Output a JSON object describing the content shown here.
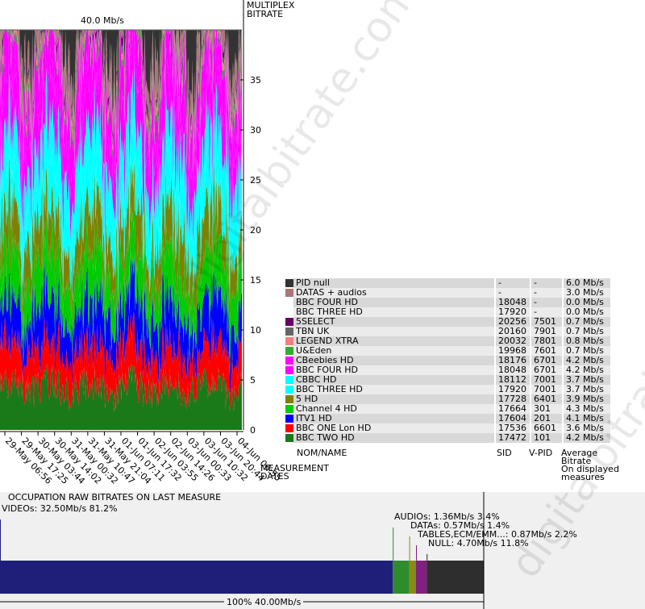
{
  "chart_data": {
    "type": "area",
    "stacked": true,
    "top_label": "40.0 Mb/s",
    "ylabel": "MULTIPLEX BITRATE",
    "xlabel": "MEASUREMENT DATES",
    "ylim": [
      0,
      40
    ],
    "yticks": [
      5,
      10,
      15,
      20,
      25,
      30,
      35
    ],
    "xticks": [
      "29-May 06:56",
      "29-May 17:25",
      "30-May 03:44",
      "30-May 14:02",
      "31-May 00:32",
      "31-May 10:47",
      "31-May 21:04",
      "01-Jun 07:11",
      "01-Jun 17:32",
      "02-Jun 03:55",
      "02-Jun 14:26",
      "03-Jun 00:33",
      "03-Jun 10:32",
      "03-Jun 20:44",
      "04-Jun 06:55"
    ],
    "series": [
      {
        "name": "BBC TWO HD",
        "color": "#1a7a1a",
        "avg": 4.2
      },
      {
        "name": "BBC ONE Lon HD",
        "color": "#ff0000",
        "avg": 3.6
      },
      {
        "name": "ITV1 HD",
        "color": "#0000ff",
        "avg": 4.1
      },
      {
        "name": "Channel 4 HD",
        "color": "#00cc00",
        "avg": 4.3
      },
      {
        "name": "5 HD",
        "color": "#808000",
        "avg": 3.9
      },
      {
        "name": "BBC THREE HD",
        "color": "#00ffff",
        "avg": 3.7
      },
      {
        "name": "CBBC HD",
        "color": "#00ffff",
        "avg": 3.7
      },
      {
        "name": "BBC FOUR HD",
        "color": "#ff00ff",
        "avg": 4.2
      },
      {
        "name": "CBeebies HD",
        "color": "#ff00ff",
        "avg": 4.2
      },
      {
        "name": "U&Eden",
        "color": "#33aa33",
        "avg": 0.7
      },
      {
        "name": "LEGEND XTRA",
        "color": "#f08080",
        "avg": 0.7
      },
      {
        "name": "TBN UK",
        "color": "#666666",
        "avg": 0.7
      },
      {
        "name": "5SELECT",
        "color": "#660066",
        "avg": 0.7
      },
      {
        "name": "DATAS + audios",
        "color": "#aa7777",
        "avg": 3.0
      },
      {
        "name": "PID null",
        "color": "#333333",
        "avg": 6.0
      }
    ]
  },
  "legend": {
    "rows": [
      {
        "name": "PID null",
        "sid": "-",
        "vpid": "-",
        "bitrate": "6.0 Mb/s",
        "color": "#333333"
      },
      {
        "name": "DATAS + audios",
        "sid": "-",
        "vpid": "-",
        "bitrate": "3.0 Mb/s",
        "color": "#aa7777"
      },
      {
        "name": "BBC FOUR HD",
        "sid": "18048",
        "vpid": "-",
        "bitrate": "0.0 Mb/s",
        "color": ""
      },
      {
        "name": "BBC THREE HD",
        "sid": "17920",
        "vpid": "-",
        "bitrate": "0.0 Mb/s",
        "color": ""
      },
      {
        "name": "5SELECT",
        "sid": "20256",
        "vpid": "7501",
        "bitrate": "0.7 Mb/s",
        "color": "#660066"
      },
      {
        "name": "TBN UK",
        "sid": "20160",
        "vpid": "7901",
        "bitrate": "0.7 Mb/s",
        "color": "#666666"
      },
      {
        "name": "LEGEND XTRA",
        "sid": "20032",
        "vpid": "7801",
        "bitrate": "0.8 Mb/s",
        "color": "#f08080"
      },
      {
        "name": "U&Eden",
        "sid": "19968",
        "vpid": "7601",
        "bitrate": "0.7 Mb/s",
        "color": "#33aa33"
      },
      {
        "name": "CBeebies HD",
        "sid": "18176",
        "vpid": "6701",
        "bitrate": "4.2 Mb/s",
        "color": "#ff00ff"
      },
      {
        "name": "BBC FOUR HD",
        "sid": "18048",
        "vpid": "6701",
        "bitrate": "4.2 Mb/s",
        "color": "#ff00ff"
      },
      {
        "name": "CBBC HD",
        "sid": "18112",
        "vpid": "7001",
        "bitrate": "3.7 Mb/s",
        "color": "#00ffff"
      },
      {
        "name": "BBC THREE HD",
        "sid": "17920",
        "vpid": "7001",
        "bitrate": "3.7 Mb/s",
        "color": "#00ffff"
      },
      {
        "name": "5 HD",
        "sid": "17728",
        "vpid": "6401",
        "bitrate": "3.9 Mb/s",
        "color": "#808000"
      },
      {
        "name": "Channel 4 HD",
        "sid": "17664",
        "vpid": "301",
        "bitrate": "4.3 Mb/s",
        "color": "#00cc00"
      },
      {
        "name": "ITV1 HD",
        "sid": "17604",
        "vpid": "201",
        "bitrate": "4.1 Mb/s",
        "color": "#0000ff"
      },
      {
        "name": "BBC ONE Lon HD",
        "sid": "17536",
        "vpid": "6601",
        "bitrate": "3.6 Mb/s",
        "color": "#ff0000"
      },
      {
        "name": "BBC TWO HD",
        "sid": "17472",
        "vpid": "101",
        "bitrate": "4.2 Mb/s",
        "color": "#1a7a1a"
      }
    ],
    "col_name": "NOM/NAME",
    "col_sid": "SID",
    "col_vpid": "V-PID",
    "col_avg_1": "Average",
    "col_avg_2": "Bitrate",
    "col_avg_3": "On displayed",
    "col_avg_4": "measures"
  },
  "occupation": {
    "title": "OCCUPATION RAW BITRATES ON LAST MEASURE",
    "total_label": "100%  40.00Mb/s",
    "segments": [
      {
        "label": "VIDEOs: 32.50Mb/s  81.2%",
        "fraction": 0.812,
        "color": "#1f1f7a",
        "text_color": "#1f1f7a"
      },
      {
        "label": "AUDIOs: 1.36Mb/s  3.4%",
        "fraction": 0.034,
        "color": "#2e8b2e",
        "text_color": "#2e8b2e"
      },
      {
        "label": "DATAs: 0.57Mb/s  1.4%",
        "fraction": 0.014,
        "color": "#8a8a1a",
        "text_color": "#8a8a1a"
      },
      {
        "label": "TABLES,ECM/EMM...: 0.87Mb/s  2.2%",
        "fraction": 0.022,
        "color": "#802080",
        "text_color": "#802080"
      },
      {
        "label": "NULL: 4.70Mb/s  11.8%",
        "fraction": 0.118,
        "color": "#2e2e2e",
        "text_color": "#222222"
      }
    ]
  },
  "watermark": "digitalbitrate.com"
}
